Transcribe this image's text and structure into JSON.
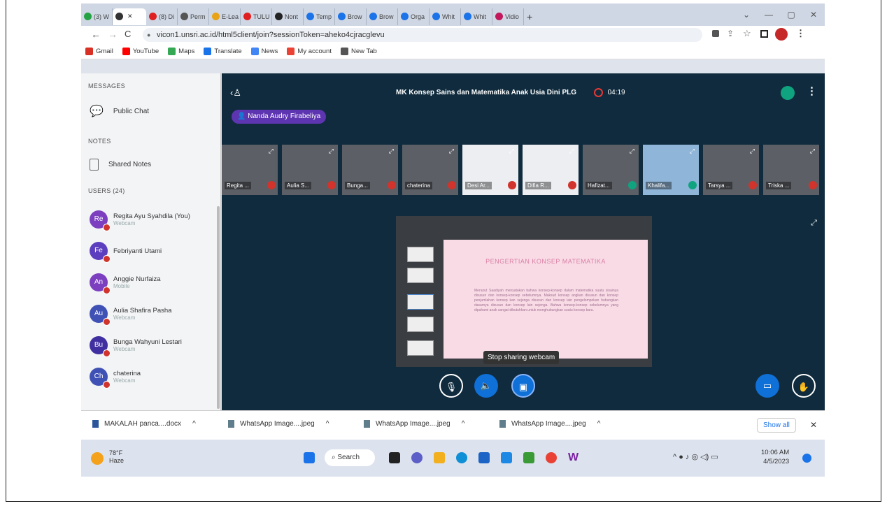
{
  "browser": {
    "tabs": [
      {
        "label": "(3) W",
        "color": "#25a244"
      },
      {
        "label": "",
        "color": "#333333",
        "active": true
      },
      {
        "label": "(8) Di",
        "color": "#e02020"
      },
      {
        "label": "Perm",
        "color": "#555555"
      },
      {
        "label": "E-Lea",
        "color": "#e8a317"
      },
      {
        "label": "TULU",
        "color": "#e02020"
      },
      {
        "label": "Nont",
        "color": "#222222"
      },
      {
        "label": "Temp",
        "color": "#1a73e8"
      },
      {
        "label": "Brow",
        "color": "#1a73e8"
      },
      {
        "label": "Brow",
        "color": "#1a73e8"
      },
      {
        "label": "Orga",
        "color": "#1a73e8"
      },
      {
        "label": "Whit",
        "color": "#1a73e8"
      },
      {
        "label": "Whit",
        "color": "#1a73e8"
      },
      {
        "label": "Vidio",
        "color": "#c2185b"
      }
    ],
    "new_tab": "+",
    "url": "vicon1.unsri.ac.id/html5client/join?sessionToken=aheko4cjracglevu",
    "bookmarks": [
      "Gmail",
      "YouTube",
      "Maps",
      "Translate",
      "News",
      "My account",
      "New Tab"
    ]
  },
  "sidebar": {
    "messages_header": "MESSAGES",
    "public_chat": "Public Chat",
    "notes_header": "NOTES",
    "shared_notes": "Shared Notes",
    "users_header": "USERS (24)",
    "users": [
      {
        "initials": "Re",
        "name": "Regita Ayu Syahdila (You)",
        "sub": "Webcam",
        "color": "#7b3fbf"
      },
      {
        "initials": "Fe",
        "name": "Febriyanti Utami",
        "sub": "",
        "color": "#5c3fbf"
      },
      {
        "initials": "An",
        "name": "Anggie Nurfaiza",
        "sub": "Mobile",
        "color": "#7b3fbf"
      },
      {
        "initials": "Au",
        "name": "Aulia Shafira Pasha",
        "sub": "Webcam",
        "color": "#3f51b5"
      },
      {
        "initials": "Bu",
        "name": "Bunga Wahyuni Lestari",
        "sub": "Webcam",
        "color": "#3f2fa0"
      },
      {
        "initials": "Ch",
        "name": "chaterina",
        "sub": "Webcam",
        "color": "#3f51b5"
      }
    ]
  },
  "meeting": {
    "title": "MK Konsep Sains dan Matematika Anak Usia Dini PLG",
    "timer": "04:19",
    "presenter": "Nanda Audry Firabeliya",
    "videos": [
      {
        "name": "Regita ...",
        "mic": "#d0342c"
      },
      {
        "name": "Aulia S...",
        "mic": "#d0342c"
      },
      {
        "name": "Bunga...",
        "mic": "#d0342c"
      },
      {
        "name": "chaterina",
        "mic": "#d0342c"
      },
      {
        "name": "Desi Ar...",
        "mic": "#d0342c"
      },
      {
        "name": "Difia R...",
        "mic": "#d0342c"
      },
      {
        "name": "Hafizat...",
        "mic": "#10a37f"
      },
      {
        "name": "Khalifa...",
        "mic": "#10a37f"
      },
      {
        "name": "Tarsya ...",
        "mic": "#d0342c"
      },
      {
        "name": "Triska ...",
        "mic": "#d0342c"
      }
    ],
    "slide_title": "PENGERTIAN KONSEP MATEMATIKA",
    "slide_body": "Menurut Saadiyah menyatakan bahwa konsep-konsep dalam matematika suatu sisainya disusun dan konsep-konsep sebelumnya. Maksud konsep angkan disusun dan konsep penjumlahan konsep kan sejenga disusun dan konsep lain pengelompokan hubungkan dasarnya disusun dan konsep lain sejenga. Bahwa konsep-konsep sebelumnya yang dipahami anak sangat dibutuhkan untuk menghubungkan suatu konsep baru.",
    "tooltip": "Stop sharing webcam"
  },
  "downloads": {
    "items": [
      "MAKALAH panca....docx",
      "WhatsApp Image....jpeg",
      "WhatsApp Image....jpeg",
      "WhatsApp Image....jpeg"
    ],
    "show_all": "Show all",
    "close": "✕"
  },
  "taskbar": {
    "weather_temp": "78°F",
    "weather_desc": "Haze",
    "search": "Search",
    "time": "10:06 AM",
    "date": "4/5/2023"
  }
}
